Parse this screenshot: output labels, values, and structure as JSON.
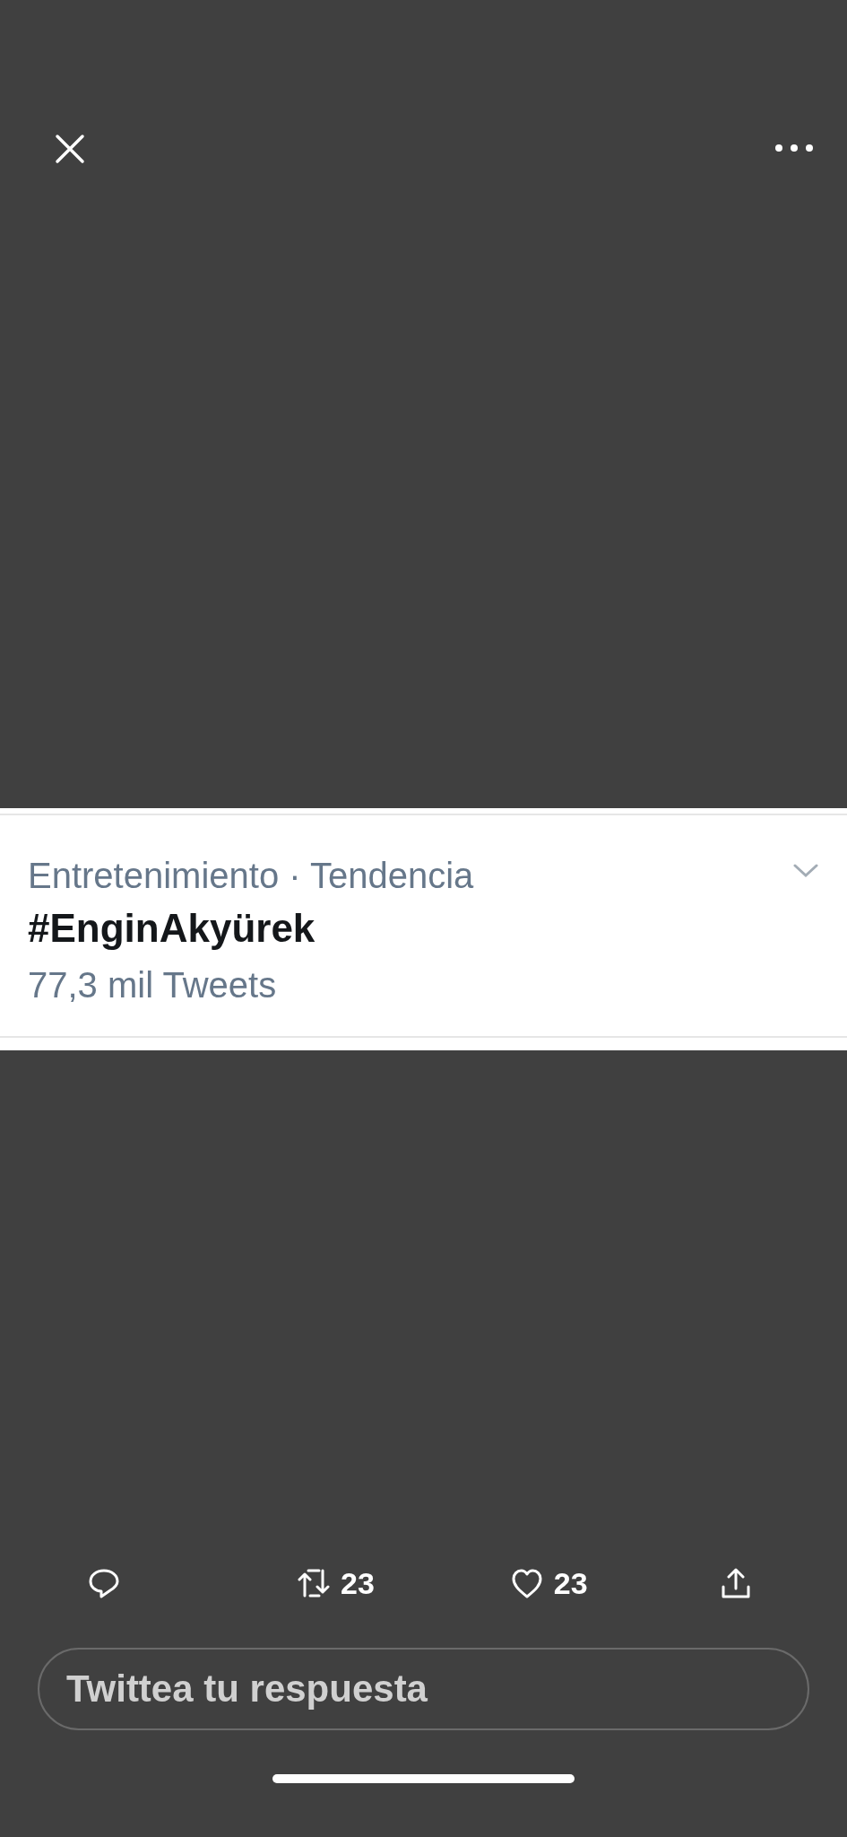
{
  "trend": {
    "context": "Entretenimiento · Tendencia",
    "hashtag": "#EnginAkyürek",
    "count": "77,3 mil Tweets"
  },
  "actions": [
    {
      "kind": "reply"
    },
    {
      "kind": "retweet",
      "count": "23"
    },
    {
      "kind": "like",
      "count": "23"
    },
    {
      "kind": "share"
    }
  ],
  "reply_field": {
    "placeholder": "Twittea tu respuesta"
  }
}
